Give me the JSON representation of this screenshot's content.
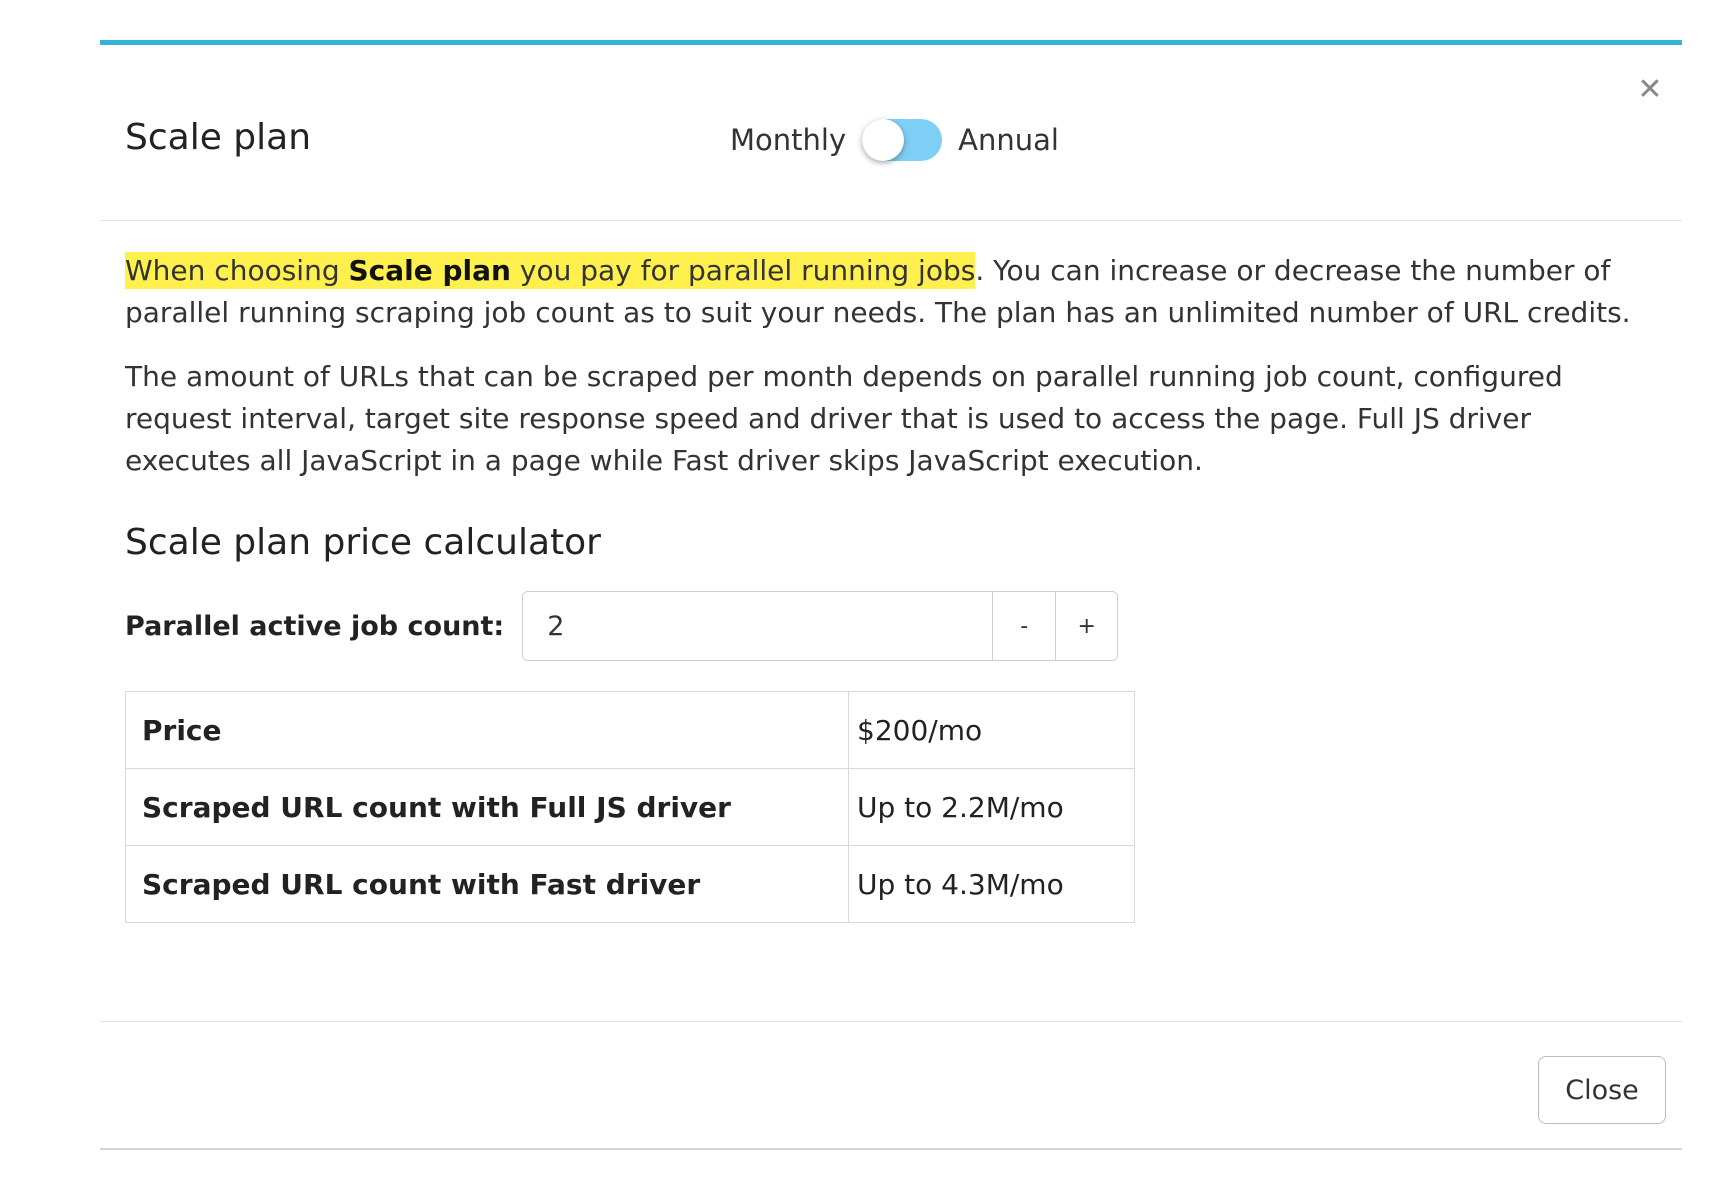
{
  "modal": {
    "title": "Scale plan",
    "close_icon": "close-icon",
    "toggle": {
      "left_label": "Monthly",
      "right_label": "Annual",
      "state": "monthly"
    }
  },
  "intro": {
    "highlight_pre": "When choosing ",
    "highlight_bold": "Scale plan",
    "highlight_post": " you pay for parallel running jobs",
    "rest": ". You can increase or decrease the number of parallel running scraping job count as to suit your needs. The plan has an unlimited number of URL credits."
  },
  "info_paragraph": "The amount of URLs that can be scraped per month depends on parallel running job count, configured request interval, target site response speed and driver that is used to access the page. Full JS driver executes all JavaScript in a page while Fast driver skips JavaScript execution.",
  "calculator": {
    "title": "Scale plan price calculator",
    "counter_label": "Parallel active job count:",
    "counter_value": "2",
    "decrement_label": "-",
    "increment_label": "+"
  },
  "table": {
    "rows": [
      {
        "label": "Price",
        "value": "$200/mo"
      },
      {
        "label": "Scraped URL count with Full JS driver",
        "value": "Up to 2.2M/mo"
      },
      {
        "label": "Scraped URL count with Fast driver",
        "value": "Up to 4.3M/mo"
      }
    ]
  },
  "footer": {
    "close_label": "Close"
  },
  "colors": {
    "accent_top_border": "#35b3d6",
    "toggle_track": "#7ecff5",
    "highlight": "#fff04d"
  }
}
